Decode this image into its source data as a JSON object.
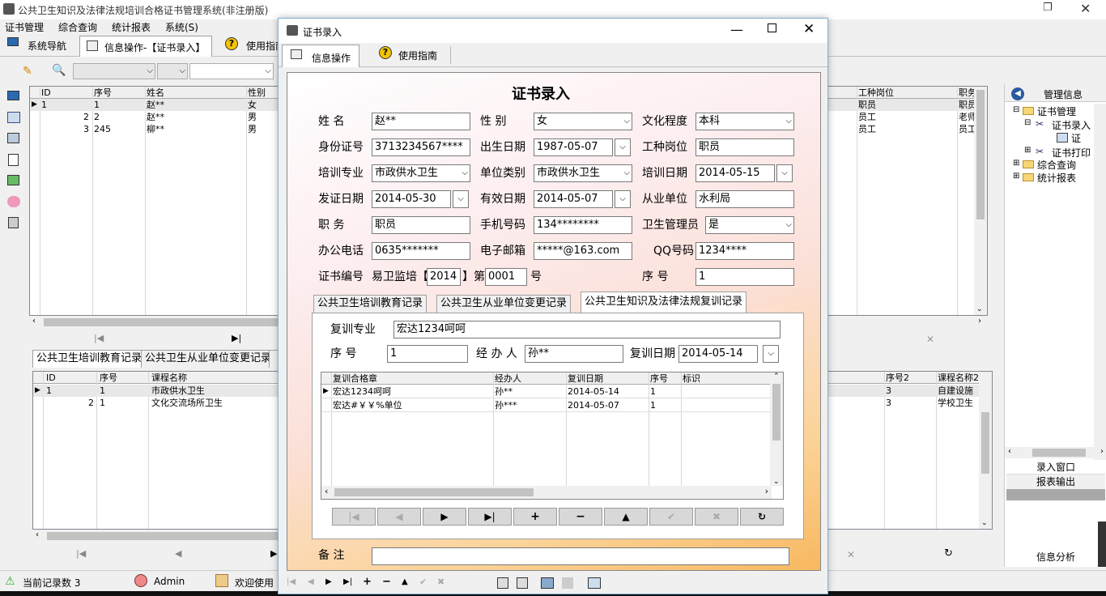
{
  "app": {
    "title": "公共卫生知识及法律法规培训合格证书管理系统(非注册版)"
  },
  "menu": [
    "证书管理",
    "综合查询",
    "统计报表",
    "系统(S)"
  ],
  "maintabs": {
    "nav": "系统导航",
    "ops": "信息操作-【证书录入】",
    "guide": "使用指南"
  },
  "topgrid": {
    "headers": [
      "ID",
      "序号",
      "姓名",
      "性别"
    ],
    "rows": [
      [
        "1",
        "1",
        "赵**",
        "女"
      ],
      [
        "2",
        "2",
        "赵**",
        "男"
      ],
      [
        "3",
        "245",
        "柳**",
        "男"
      ]
    ],
    "right_headers": [
      "工种岗位",
      "职务"
    ],
    "right_rows": [
      [
        "职员",
        "职员"
      ],
      [
        "员工",
        "老师"
      ],
      [
        "员工",
        "员工"
      ]
    ]
  },
  "bottomtabs": [
    "公共卫生培训教育记录",
    "公共卫生从业单位变更记录"
  ],
  "bottomgrid": {
    "headers": [
      "ID",
      "序号",
      "课程名称"
    ],
    "rows": [
      [
        "1",
        "1",
        "市政供水卫生"
      ],
      [
        "2",
        "1",
        "文化交流场所卫生"
      ]
    ],
    "right_headers": [
      "序号2",
      "课程名称2"
    ],
    "right_rows": [
      [
        "3",
        "自建设施"
      ],
      [
        "3",
        "学校卫生"
      ]
    ]
  },
  "rightpanel": {
    "title": "管理信息",
    "tree": [
      "证书管理",
      "证书录入",
      "证",
      "证书打印",
      "综合查询",
      "统计报表"
    ],
    "buttons": [
      "录入窗口",
      "报表输出"
    ],
    "bottom": "信息分析"
  },
  "status": {
    "count": "当前记录数 3",
    "user": "Admin",
    "welcome": "欢迎使用"
  },
  "dialog": {
    "title": "证书录入",
    "tabs": {
      "ops": "信息操作",
      "guide": "使用指南"
    },
    "heading": "证书录入",
    "fields": {
      "name_l": "姓    名",
      "name": "赵**",
      "sex_l": "性    别",
      "sex": "女",
      "edu_l": "文化程度",
      "edu": "本科",
      "id_l": "身份证号",
      "id": "3713234567****",
      "birth_l": "出生日期",
      "birth": "1987-05-07",
      "job_l": "工种岗位",
      "job": "职员",
      "major_l": "培训专业",
      "major": "市政供水卫生",
      "unittype_l": "单位类别",
      "unittype": "市政供水卫生",
      "traindate_l": "培训日期",
      "traindate": "2014-05-15",
      "issuedate_l": "发证日期",
      "issuedate": "2014-05-30",
      "validdate_l": "有效日期",
      "validdate": "2014-05-07",
      "unit_l": "从业单位",
      "unit": "水利局",
      "post_l": "职    务",
      "post": "职员",
      "mobile_l": "手机号码",
      "mobile": "134********",
      "mgr_l": "卫生管理员",
      "mgr": "是",
      "tel_l": "办公电话",
      "tel": "0635*******",
      "email_l": "电子邮箱",
      "email": "*****@163.com",
      "qq_l": "QQ号码",
      "qq": "1234****",
      "certno_l": "证书编号",
      "cert_prefix": "易卫监培【",
      "cert_year": "2014",
      "cert_mid": "】第",
      "cert_num": "0001",
      "cert_suffix": "号",
      "seq_l": "序    号",
      "seq": "1",
      "remark_l": "备    注",
      "remark": ""
    },
    "subtabs": [
      "公共卫生培训教育记录",
      "公共卫生从业单位变更记录",
      "公共卫生知识及法律法规复训记录"
    ],
    "re": {
      "major_l": "复训专业",
      "major": "宏达1234呵呵",
      "seq_l": "序    号",
      "seq": "1",
      "handler_l": "经 办 人",
      "handler": "孙**",
      "date_l": "复训日期",
      "date": "2014-05-14"
    },
    "regrid": {
      "headers": [
        "复训合格章",
        "经办人",
        "复训日期",
        "序号",
        "标识"
      ],
      "rows": [
        [
          "宏达1234呵呵",
          "孙**",
          "2014-05-14",
          "1",
          ""
        ],
        [
          "宏达#￥￥%单位",
          "孙***",
          "2014-05-07",
          "1",
          ""
        ]
      ]
    },
    "nav": [
      "|◀",
      "◀",
      "▶",
      "▶|",
      "+",
      "−",
      "▲",
      "✔",
      "✖",
      "↻"
    ]
  }
}
